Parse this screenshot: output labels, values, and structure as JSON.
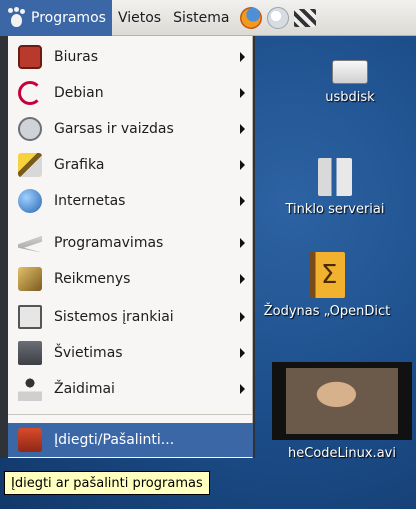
{
  "panel": {
    "menus": [
      "Programos",
      "Vietos",
      "Sistema"
    ],
    "launchers": [
      "firefox-icon",
      "help-icon",
      "clapperboard-icon"
    ]
  },
  "applications_menu": {
    "items": [
      {
        "label": "Biuras",
        "icon": "briefcase-icon",
        "submenu": true
      },
      {
        "label": "Debian",
        "icon": "debian-icon",
        "submenu": true
      },
      {
        "label": "Garsas ir vaizdas",
        "icon": "sound-video-icon",
        "submenu": true
      },
      {
        "label": "Grafika",
        "icon": "graphics-icon",
        "submenu": true
      },
      {
        "label": "Internetas",
        "icon": "globe-icon",
        "submenu": true
      },
      {
        "label": "Programavimas",
        "icon": "development-icon",
        "submenu": true
      },
      {
        "label": "Reikmenys",
        "icon": "accessories-icon",
        "submenu": true
      },
      {
        "label": "Sistemos įrankiai",
        "icon": "system-tools-icon",
        "submenu": true
      },
      {
        "label": "Švietimas",
        "icon": "education-folder-icon",
        "submenu": true
      },
      {
        "label": "Žaidimai",
        "icon": "joystick-icon",
        "submenu": true
      }
    ],
    "footer_item": {
      "label": "Įdiegti/Pašalinti...",
      "icon": "install-remove-icon"
    }
  },
  "tooltip": {
    "text": "Įdiegti ar pašalinti programas"
  },
  "desktop": {
    "icons": [
      {
        "label": "usbdisk",
        "icon": "usb-disk-icon"
      },
      {
        "label": "Tinklo serveriai",
        "icon": "network-servers-icon"
      },
      {
        "label": "Žodynas „OpenDict",
        "icon": "dictionary-icon"
      },
      {
        "label": "heCodeLinux.avi",
        "icon": "video-thumbnail"
      }
    ]
  }
}
